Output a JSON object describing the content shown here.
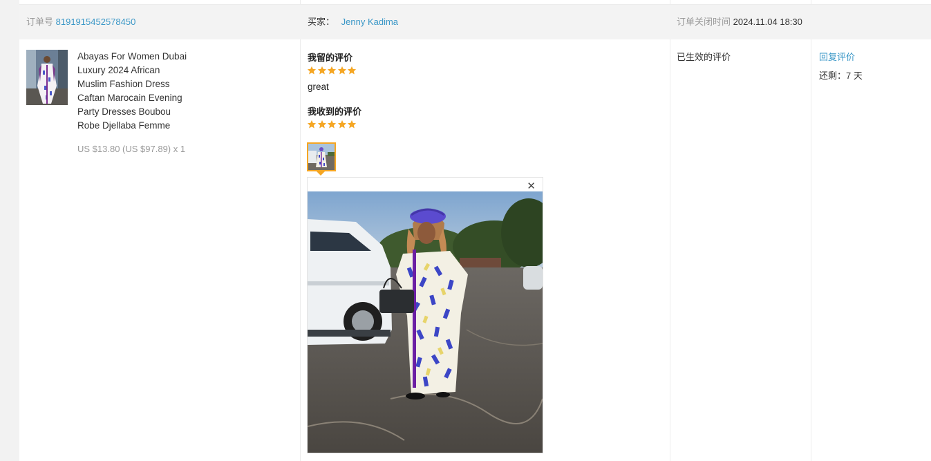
{
  "order_header": {
    "order_no_label": "订单号",
    "order_no": "8191915452578450",
    "buyer_label": "买家：",
    "buyer_name": "Jenny Kadima",
    "close_time_label": "订单关闭时间",
    "close_time": "2024.11.04 18:30"
  },
  "product": {
    "title_lines": [
      "Abayas For Women Dubai",
      "Luxury 2024 African",
      "Muslim Fashion Dress",
      "Caftan Marocain Evening",
      "Party Dresses Boubou",
      "Robe Djellaba Femme"
    ],
    "price": "US $13.80 (US $97.89) x 1"
  },
  "review": {
    "my_review_label": "我留的评价",
    "my_rating": 5,
    "my_comment": "great",
    "received_review_label": "我收到的评价",
    "received_rating": 5,
    "close_icon": "close-icon"
  },
  "status": {
    "text": "已生效的评价"
  },
  "actions": {
    "reply_label": "回复评价",
    "remaining_label": "还剩：",
    "remaining_value": "7 天"
  },
  "colors": {
    "link": "#3a97c7",
    "star": "#f5a623",
    "header_bg": "#f3f3f3"
  }
}
